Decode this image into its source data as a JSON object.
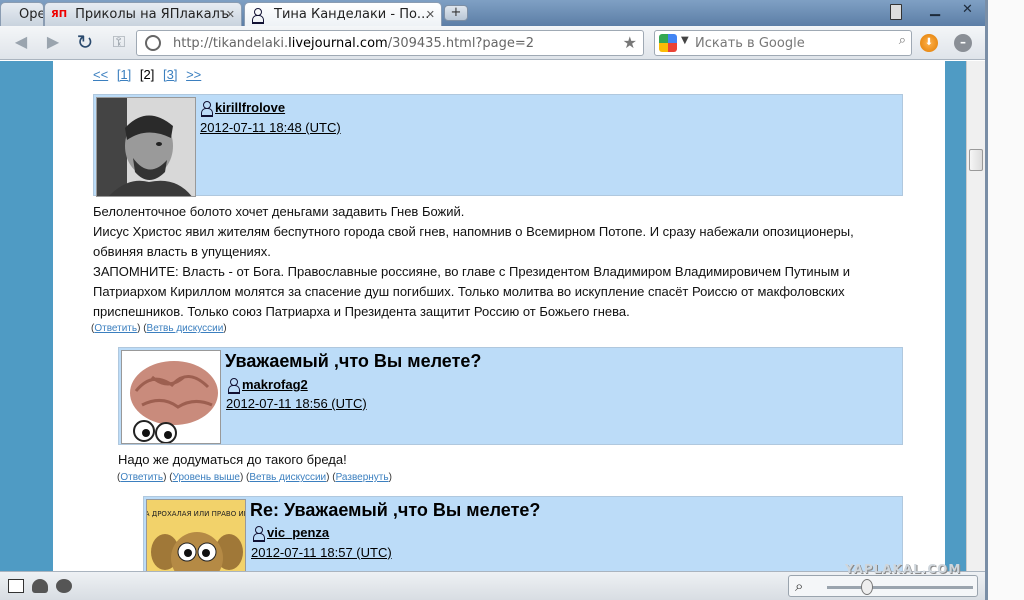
{
  "tabs": [
    {
      "label": "Opera"
    },
    {
      "icon_text": "ЯП",
      "label": "Приколы на ЯПлакалъ"
    },
    {
      "label": "Тина Канделаки - По..."
    }
  ],
  "address_bar": {
    "url_prefix": "http://tikandelaki.",
    "url_host": "livejournal.com",
    "url_path": "/309435.html?page=2"
  },
  "search": {
    "placeholder": "Искать в Google"
  },
  "pager": {
    "prev": "<<",
    "p1": "[1]",
    "p2": "[2]",
    "p3": "[3]",
    "next": ">>"
  },
  "comments": [
    {
      "user": "kirillfrolove",
      "date": "2012-07-11 18:48 (UTC)",
      "body": [
        "Белоленточное болото хочет деньгами задавить Гнев Божий.",
        "Иисус Христос явил жителям беспутного города свой гнев, напомнив о Всемирном Потопе. И сразу набежали опозиционеры,",
        "обвиняя власть в упущениях.",
        "ЗАПОМНИТЕ: Власть - от Бога. Православные россияне, во главе с Президентом Владимиром Владимировичем Путиным и",
        "Патриархом Кириллом молятся за спасение душ погибших. Только молитва во искупление спасёт Роиссю от макфоловских",
        "приспешников. Только союз Патриарха и Президента защитит Россию от Божьего гнева."
      ],
      "actions": {
        "reply": "Ответить",
        "thread": "Ветвь дискуссии"
      }
    },
    {
      "subject": "Уважаемый ,что Вы мелете?",
      "user": "makrofag2",
      "date": "2012-07-11 18:56 (UTC)",
      "body": [
        "Надо же додуматься до такого бреда!"
      ],
      "actions": {
        "reply": "Ответить",
        "up": "Уровень выше",
        "thread": "Ветвь дискуссии",
        "expand": "Развернуть"
      }
    },
    {
      "subject": "Re: Уважаемый ,что Вы мелете?",
      "user": "vic_penza",
      "date": "2012-07-11 18:57 (UTC)",
      "avatar_text": "ТЕБЯ А ДРОХАЛАЯ ИЛИ ПРАВО ИМЕЮ..?"
    }
  ],
  "watermark": "YAPLAKAL.COM"
}
